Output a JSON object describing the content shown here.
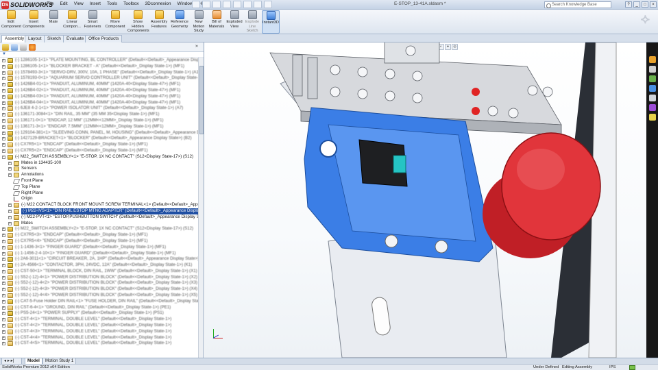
{
  "app": {
    "brand": "SOLIDWORKS",
    "brand_prefix": "DS",
    "document_title": "E-STOP_13-41A.sldasm *",
    "search_placeholder": "Search Knowledge Base",
    "window_buttons": [
      "?",
      "_",
      "□",
      "×"
    ]
  },
  "menu": [
    "File",
    "Edit",
    "View",
    "Insert",
    "Tools",
    "Toolbox",
    "3Dconnexion",
    "Window",
    "Help"
  ],
  "ribbon": [
    {
      "label": "Edit\nComponent",
      "icon": "edit-component-icon",
      "color": "y"
    },
    {
      "label": "Insert\nComponents",
      "icon": "insert-components-icon",
      "color": "y"
    },
    {
      "label": "Mate",
      "icon": "mate-icon",
      "color": "g"
    },
    {
      "label": "Linear\nCompon...",
      "icon": "linear-pattern-icon",
      "color": "y"
    },
    {
      "label": "Smart\nFasteners",
      "icon": "smart-fasteners-icon",
      "color": "g"
    },
    {
      "label": "Move\nComponent",
      "icon": "move-component-icon",
      "color": "y"
    },
    {
      "label": "Show\nHidden\nComponents",
      "icon": "show-hidden-icon",
      "color": "y"
    },
    {
      "label": "Assembly\nFeatures",
      "icon": "assembly-features-icon",
      "color": "y"
    },
    {
      "label": "Reference\nGeometry",
      "icon": "reference-geometry-icon",
      "color": "b"
    },
    {
      "label": "New\nMotion\nStudy",
      "icon": "motion-study-icon",
      "color": "g"
    },
    {
      "label": "Bill of\nMaterials",
      "icon": "bom-icon",
      "color": "o"
    },
    {
      "label": "Exploded\nView",
      "icon": "exploded-view-icon",
      "color": "g"
    },
    {
      "label": "Explode\nLine\nSketch",
      "icon": "explode-line-icon",
      "color": "g"
    },
    {
      "label": "Instant3D",
      "icon": "instant3d-icon",
      "color": "b"
    }
  ],
  "tabs": [
    "Assembly",
    "Layout",
    "Sketch",
    "Evaluate",
    "Office Products"
  ],
  "tree": [
    {
      "text": "(-) 1286105-1<1> \"PLATE MOUNTING, BL CONTROLLER\" (Default<<Default>_Appearance Display State>) (MF1)",
      "type": "asm",
      "indent": 1,
      "blur": true
    },
    {
      "text": "(-) 1286105-1<1> \"BLOCKER BRACKET - A\" (Default<<Default>_Display State-1>) (MF1)",
      "type": "asm",
      "indent": 1,
      "blur": true
    },
    {
      "text": "(-) 1578493-3<1> \"SERVO-DRV, 300V, 10A, 1 PHASE\" (Default<<Default>_Display State-1>) (A1)",
      "type": "part",
      "indent": 1,
      "blur": true
    },
    {
      "text": "(-) 1578193-0<1> \"AQUARIUM SERVO CONTROLLER UNIT\" (Default<<Default>_Display State-1>) (A1)",
      "type": "part",
      "indent": 1,
      "blur": true
    },
    {
      "text": "(-) 1426B4-01<1> \"PANDUIT, ALUMINUM, 40MM\" (1420A-40<Display State-47>) (MF1)",
      "type": "asm",
      "indent": 1,
      "blur": true
    },
    {
      "text": "(-) 1426B4-02<1> \"PANDUIT, ALUMINUM, 40MM\" (1420A-40<Display State-47>) (MF1)",
      "type": "asm",
      "indent": 1,
      "blur": true
    },
    {
      "text": "(-) 1426B4-03<1> \"PANDUIT, ALUMINUM, 40MM\" (1420A-40<Display State-47>) (MF1)",
      "type": "asm",
      "indent": 1,
      "blur": true
    },
    {
      "text": "(-) 1426B4-04<1> \"PANDUIT, ALUMINUM, 40MM\" (1420A-40<Display State-47>) (MF1)",
      "type": "asm",
      "indent": 1,
      "blur": true
    },
    {
      "text": "(-) 6JE8 4-2-1<1> \"POWER ISOLATOR UNIT\" (Default<<Default>_Display State-1>) (A7)",
      "type": "part",
      "indent": 1,
      "blur": true
    },
    {
      "text": "(-) 136171-3084<1> \"DIN RAIL, 35 MM\" (35 MM 35<Display State-1>) (MF1)",
      "type": "part",
      "indent": 1,
      "blur": true
    },
    {
      "text": "(-) 136171-0<1> \"ENDCAP, 12 MM\" (12MM<<12MM>_Display State-1>) (MF1)",
      "type": "part",
      "indent": 1,
      "blur": true
    },
    {
      "text": "(-) 136171-3<1> \"ENDCAP, 7.5MM\" (12MM<<12MM>_Display State-1>) (MF1)",
      "type": "part",
      "indent": 1,
      "blur": true
    },
    {
      "text": "(-) 129104-381<1> \"SLEEVING CONN, PANEL, M, HOUSING\" (Default<<Default>_Appearance Display State>) (MF1)",
      "type": "asm",
      "indent": 1,
      "blur": true
    },
    {
      "text": "(-) 1427129-BRACKET<1> \"BLOCKER\" (Default<<Default>_Appearance Display State>) (B2)",
      "type": "asm",
      "indent": 1,
      "blur": true
    },
    {
      "text": "(-) CX7R5<1> \"ENDCAP\" (Default<<Default>_Display State-1>) (MF1)",
      "type": "part",
      "indent": 1,
      "blur": true
    },
    {
      "text": "(-) CX7R5<2> \"ENDCAP\" (Default<<Default>_Display State-1>) (MF1)",
      "type": "part",
      "indent": 1,
      "blur": true
    },
    {
      "text": "(-) M22_SWITCH ASSEMBLY<1> \"E-STOP, 1X NC CONTACT\" (S12<Display State-17>) (S12)",
      "type": "asm",
      "indent": 1,
      "expanded": true
    },
    {
      "text": "Mates in 134435-100",
      "type": "fold",
      "indent": 2
    },
    {
      "text": "Sensors",
      "type": "fold",
      "indent": 2
    },
    {
      "text": "Annotations",
      "type": "fold",
      "indent": 2
    },
    {
      "text": "Front Plane",
      "type": "plane",
      "indent": 2
    },
    {
      "text": "Top Plane",
      "type": "plane",
      "indent": 2
    },
    {
      "text": "Right Plane",
      "type": "plane",
      "indent": 2
    },
    {
      "text": "Origin",
      "type": "origin",
      "indent": 2
    },
    {
      "text": "(-) M22 CONTACT BLOCK FRONT MOUNT SCREW TERMINAL<1> (Default<<Default>_Appearance Display S",
      "type": "part",
      "indent": 2
    },
    {
      "text": "(-) M22-IVS<1> \"DIN RAIL ESTOP MTNG ADAPTER\" (Default<<Default>_Appearance Display State>) (S12)",
      "type": "part",
      "indent": 2,
      "selected": true
    },
    {
      "text": "(-) M22-PVT<1> \"ESTOP,PUSHBUTTON SWITCH\" (Default<<Default>_Appearance Display State>)",
      "type": "part",
      "indent": 2
    },
    {
      "text": "Mates",
      "type": "fold",
      "indent": 2
    },
    {
      "text": "(-) M22_SWITCH ASSEMBLY<2> \"E-STOP, 1X NC CONTACT\" (S12<Display State-17>) (S12)",
      "type": "asm",
      "indent": 1,
      "blur": true
    },
    {
      "text": "(-) CX7R5<3> \"ENDCAP\" (Default<<Default>_Display State-1>) (MF1)",
      "type": "part",
      "indent": 1,
      "blur": true
    },
    {
      "text": "(-) CX7R5<4> \"ENDCAP\" (Default<<Default>_Display State-1>) (MF1)",
      "type": "part",
      "indent": 1,
      "blur": true
    },
    {
      "text": "(-) 1-1436-3<1> \"FINGER GUARD\" (Default<<Default>_Display State-1>) (MF1)",
      "type": "part",
      "indent": 1,
      "blur": true
    },
    {
      "text": "(-) 1-1456-2-4-10<1> \"FINGER GUARD\" (Default<<Default>_Display State-1>) (MF1)",
      "type": "part",
      "indent": 1,
      "blur": true
    },
    {
      "text": "(-) 2A6-3011<1> \"CIRCUIT BREAKER, 2A, 1HP\" (Default<<Default>_Appearance Display State>) (CB1)",
      "type": "asm",
      "indent": 1,
      "blur": true
    },
    {
      "text": "(-) 2A-4566<1> \"CONTACTOR, 3PH, 24VDC, 12A\" (Default<<Default>_Display State-1>) (K1)",
      "type": "asm",
      "indent": 1,
      "blur": true
    },
    {
      "text": "(-) CST-50<1> \"TERMINAL BLOCK, DIN RAIL, 1WW\" (Default<<Default>_Display State-1>) (X1)",
      "type": "part",
      "indent": 1,
      "blur": true
    },
    {
      "text": "(-) S52-(-12)-4<1> \"POWER DISTRIBUTION BLOCK\" (Default<<Default>_Display State-1>) (X2)",
      "type": "part",
      "indent": 1,
      "blur": true
    },
    {
      "text": "(-) S52-(-12)-4<2> \"POWER DISTRIBUTION BLOCK\" (Default<<Default>_Display State-1>) (X3)",
      "type": "part",
      "indent": 1,
      "blur": true
    },
    {
      "text": "(-) S52-(-12)-4<3> \"POWER DISTRIBUTION BLOCK\" (Default<<Default>_Display State-1>) (X4)",
      "type": "part",
      "indent": 1,
      "blur": true
    },
    {
      "text": "(-) S52-(-12)-4<4> \"POWER DISTRIBUTION BLOCK\" (Default<<Default>_Display State-1>) (X5)",
      "type": "part",
      "indent": 1,
      "blur": true
    },
    {
      "text": "(-) CAT-5-Fuse Holder DIN RAIL<1> \"FUSE HOLDER, DIN RAIL\" (Default<<Default>_Display State-1>) (F1)",
      "type": "asm",
      "indent": 1,
      "blur": true
    },
    {
      "text": "(-) CST-6-4<1> \"GROUND, DIN RAIL\" (Default<<Default>_Display State-1>) (PE1)",
      "type": "part",
      "indent": 1,
      "blur": true
    },
    {
      "text": "(-) PS5-24<1> \"POWER SUPPLY\" (Default<<Default>_Display State-1>) (PS1)",
      "type": "asm",
      "indent": 1,
      "blur": true
    },
    {
      "text": "(-) CST-4<1> \"TERMINAL, DOUBLE LEVEL\" (Default<<Default>_Display State-1>)",
      "type": "part",
      "indent": 1,
      "blur": true
    },
    {
      "text": "(-) CST-4<2> \"TERMINAL, DOUBLE LEVEL\" (Default<<Default>_Display State-1>)",
      "type": "part",
      "indent": 1,
      "blur": true
    },
    {
      "text": "(-) CST-4<3> \"TERMINAL, DOUBLE LEVEL\" (Default<<Default>_Display State-1>)",
      "type": "part",
      "indent": 1,
      "blur": true
    },
    {
      "text": "(-) CST-4<4> \"TERMINAL, DOUBLE LEVEL\" (Default<<Default>_Display State-1>)",
      "type": "part",
      "indent": 1,
      "blur": true
    },
    {
      "text": "(-) CST-4<5> \"TERMINAL, DOUBLE LEVEL\" (Default<<Default>_Display State-1>)",
      "type": "part",
      "indent": 1,
      "blur": true
    }
  ],
  "bottom_tabs": [
    "Model",
    "Motion Study 1"
  ],
  "status": {
    "left": "SolidWorks Premium 2012 x64 Edition",
    "defined": "Under Defined",
    "mode": "Editing Assembly",
    "units": "IPS"
  },
  "colors": {
    "accent": "#1f4fa3",
    "model_blue": "#3b7ee6",
    "estop_red": "#d8232a"
  }
}
